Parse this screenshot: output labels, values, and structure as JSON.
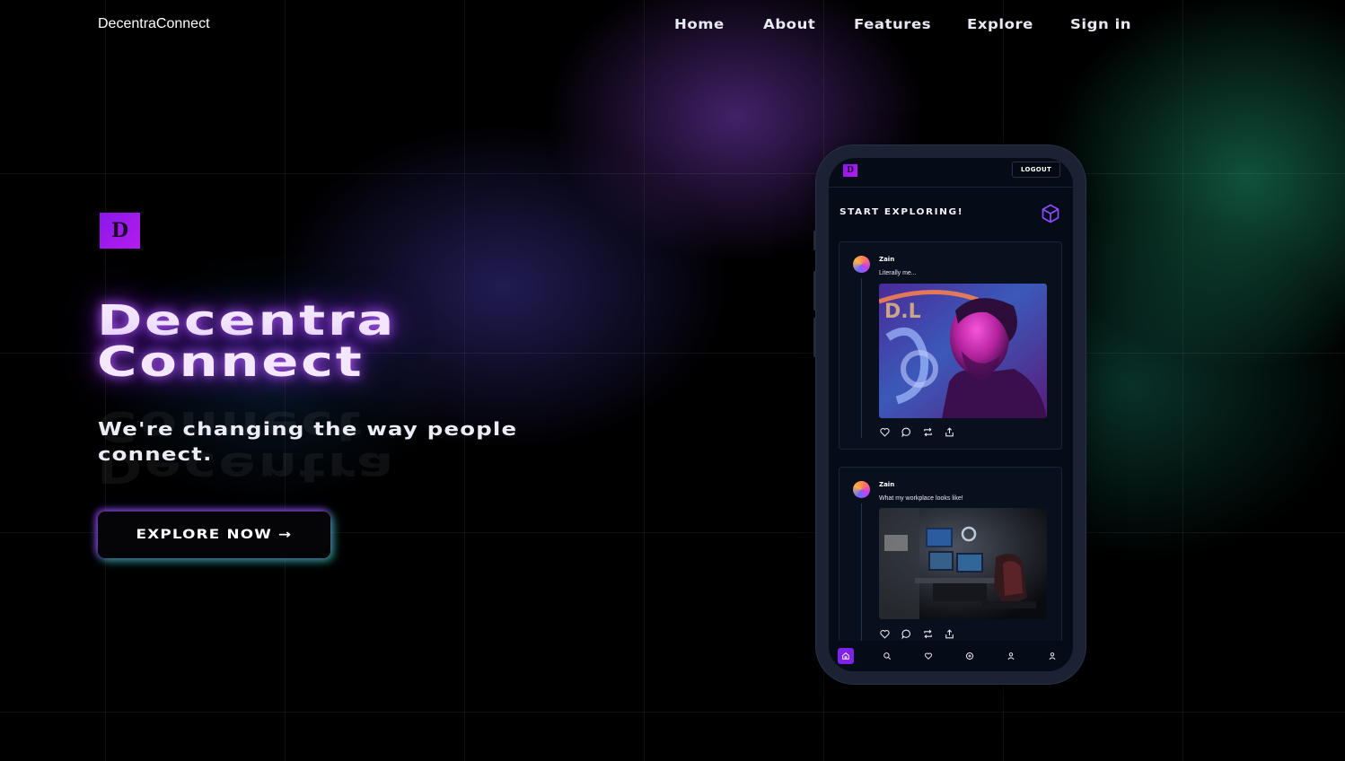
{
  "brand": "DecentraConnect",
  "nav": {
    "items": [
      "Home",
      "About",
      "Features",
      "Explore",
      "Sign in"
    ]
  },
  "hero": {
    "logo_letter": "D",
    "title_line1": "Decentra",
    "title_line2": "Connect",
    "tagline": "We're changing the way people connect.",
    "cta_label": "EXPLORE NOW →"
  },
  "phone": {
    "logo_letter": "D",
    "logout_label": "LOGOUT",
    "title": "START EXPLORING!",
    "posts": [
      {
        "user": "Zain",
        "text": "Literally me..."
      },
      {
        "user": "Zain",
        "text": "What my workplace looks like!"
      }
    ],
    "tabs": [
      "home-icon",
      "search-icon",
      "heart-icon",
      "plus-circle-icon",
      "user-icon",
      "profile-icon"
    ]
  },
  "colors": {
    "accent_purple": "#8a17e8",
    "glow_green": "#28dca0",
    "background": "#000000"
  }
}
